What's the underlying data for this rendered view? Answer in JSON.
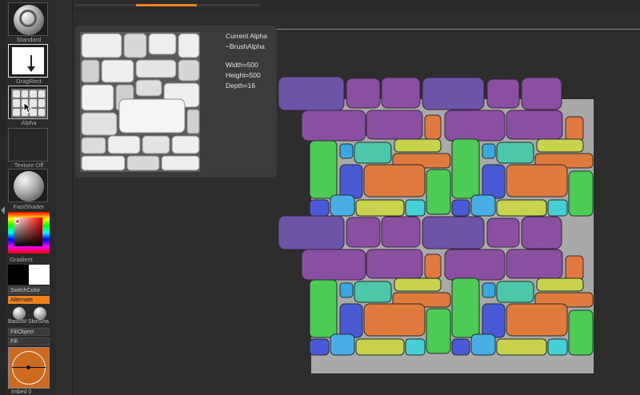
{
  "left_panel": {
    "slots": [
      {
        "label": "Standard"
      },
      {
        "label": "DragRect"
      },
      {
        "label": "Alpha"
      },
      {
        "label": "Texture Off"
      },
      {
        "label": "FastShader"
      }
    ],
    "gradient_label": "Gradient",
    "switch_color_label": "SwitchColor",
    "alternate_label": "Alternate",
    "materials": {
      "label_left": "BasicM",
      "label_right": "SkinSha"
    },
    "fill_object_label": "FillObject",
    "fill_label": "Fill",
    "imbed_label": "Imbed 0"
  },
  "top_progress": {
    "fraction": 0.33,
    "color": "#f0801a"
  },
  "alpha_popup": {
    "title": "Current Alpha",
    "name": "~BrushAlpha",
    "width": "Width=500",
    "height": "Height=500",
    "depth": "Depth=16"
  },
  "colors": {
    "accent": "#f0801a",
    "purple": "#8a4fa0",
    "slate_purple": "#6a55a6",
    "orange": "#e07a3c",
    "green": "#4ccc55",
    "lime": "#c8d24a",
    "teal": "#4cc8a8",
    "cyan": "#44d0d6",
    "blue": "#4a5ad6",
    "sky": "#3aa8e0",
    "light_blue": "#4aaee6",
    "grey_plane": "#a9a9a9"
  }
}
